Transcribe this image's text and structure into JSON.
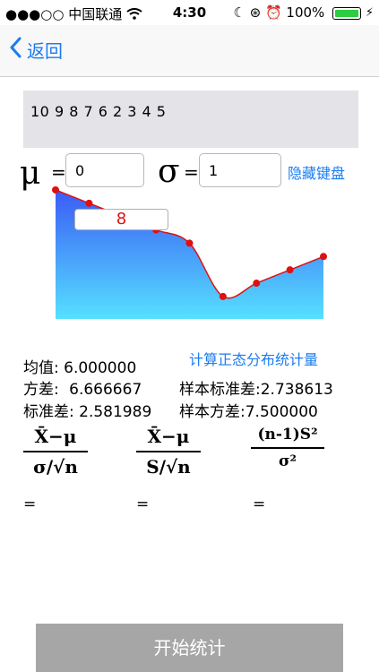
{
  "status": {
    "signal": "●●●○○",
    "carrier": "中国联通",
    "time": "4:30",
    "battery": "100%"
  },
  "nav": {
    "back_label": "返回"
  },
  "data_input": {
    "value": "10 9 8 7 6 2 3 4 5"
  },
  "params": {
    "mu_symbol": "μ",
    "mu_equals": "=",
    "mu_value": "0",
    "sigma_symbol": "σ",
    "sigma_equals": "=",
    "sigma_value": "1",
    "hide_keyboard_label": "隐藏键盘"
  },
  "chart_data": {
    "type": "area",
    "x": [
      1,
      2,
      3,
      4,
      5,
      6,
      7,
      8,
      9
    ],
    "values": [
      10,
      9,
      8,
      7,
      6,
      2,
      3,
      4,
      5
    ],
    "selected_value": "8",
    "colors": {
      "fill_top": "#3b5bf5",
      "fill_bottom": "#56e0ff",
      "line": "#e01010",
      "point": "#e01010"
    }
  },
  "calc_link": "计算正态分布统计量",
  "results": {
    "mean_label": "均值:",
    "mean_value": "6.000000",
    "variance_label": "方差:",
    "variance_value": "6.666667",
    "std_label": "标准差:",
    "std_value": "2.581989",
    "sample_std_label": "样本标准差:",
    "sample_std_value": "2.738613",
    "sample_var_label": "样本方差:",
    "sample_var_value": "7.500000"
  },
  "formulas": {
    "f1_num": "X̄−μ",
    "f1_den": "σ/√n",
    "f2_num": "X̄−μ",
    "f2_den": "S/√n",
    "f3_num": "(n-1)S²",
    "f3_den": "σ²",
    "equals": "="
  },
  "start_button": "开始统计"
}
